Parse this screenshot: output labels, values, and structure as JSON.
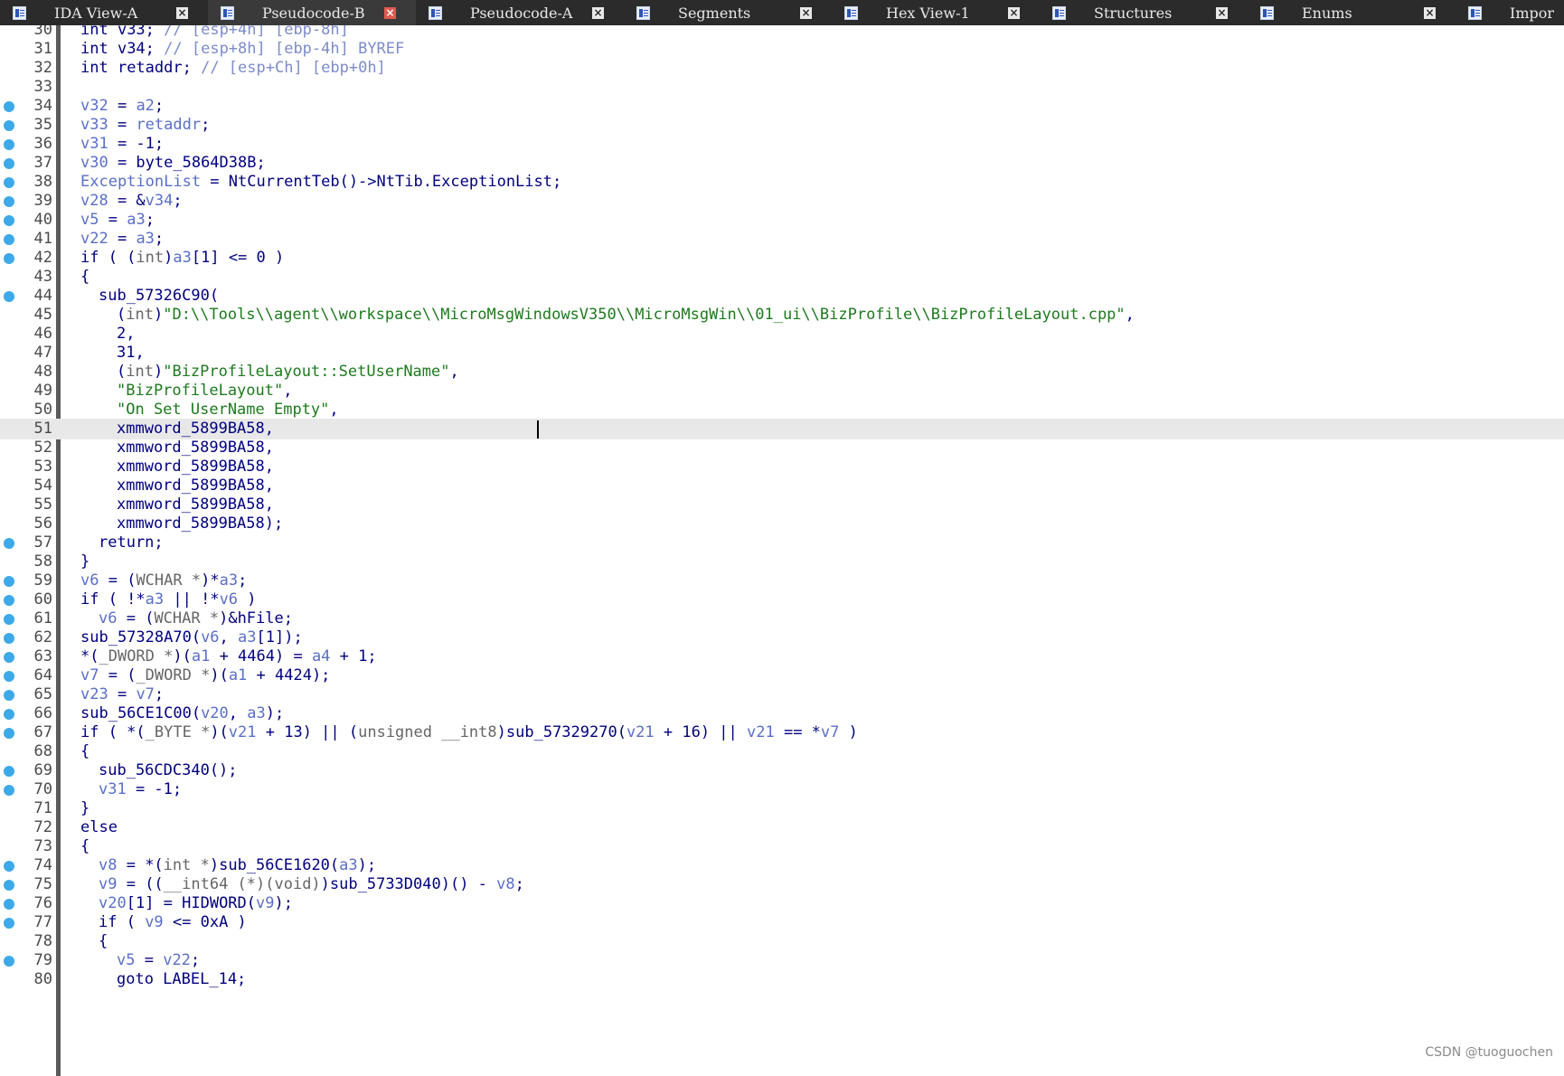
{
  "tabs": [
    {
      "label": "IDA View-A",
      "active": false,
      "close": "×"
    },
    {
      "label": "Pseudocode-B",
      "active": true,
      "close": "×"
    },
    {
      "label": "Pseudocode-A",
      "active": false,
      "close": "×"
    },
    {
      "label": "Segments",
      "active": false,
      "close": "×"
    },
    {
      "label": "Hex View-1",
      "active": false,
      "close": "×"
    },
    {
      "label": "Structures",
      "active": false,
      "close": "×"
    },
    {
      "label": "Enums",
      "active": false,
      "close": "×"
    },
    {
      "label": "Impor",
      "active": false,
      "close": ""
    }
  ],
  "current_line": 51,
  "lines": [
    {
      "n": "30",
      "bp": false,
      "indent": 1,
      "tokens": [
        [
          "p",
          "int "
        ],
        [
          "p",
          "v33"
        ],
        [
          "p",
          "; "
        ],
        [
          "c",
          "// [esp+4h] [ebp-8h]"
        ]
      ]
    },
    {
      "n": "31",
      "bp": false,
      "indent": 1,
      "tokens": [
        [
          "p",
          "int "
        ],
        [
          "p",
          "v34"
        ],
        [
          "p",
          "; "
        ],
        [
          "c",
          "// [esp+8h] [ebp-4h] BYREF"
        ]
      ]
    },
    {
      "n": "32",
      "bp": false,
      "indent": 1,
      "tokens": [
        [
          "p",
          "int "
        ],
        [
          "p",
          "retaddr"
        ],
        [
          "p",
          "; "
        ],
        [
          "c",
          "// [esp+Ch] [ebp+0h]"
        ]
      ]
    },
    {
      "n": "33",
      "bp": false,
      "indent": 1,
      "tokens": []
    },
    {
      "n": "34",
      "bp": true,
      "indent": 1,
      "tokens": [
        [
          "v",
          "v32"
        ],
        [
          "p",
          " = "
        ],
        [
          "v",
          "a2"
        ],
        [
          "p",
          ";"
        ]
      ]
    },
    {
      "n": "35",
      "bp": true,
      "indent": 1,
      "tokens": [
        [
          "v",
          "v33"
        ],
        [
          "p",
          " = "
        ],
        [
          "v",
          "retaddr"
        ],
        [
          "p",
          ";"
        ]
      ]
    },
    {
      "n": "36",
      "bp": true,
      "indent": 1,
      "tokens": [
        [
          "v",
          "v31"
        ],
        [
          "p",
          " = -1;"
        ]
      ]
    },
    {
      "n": "37",
      "bp": true,
      "indent": 1,
      "tokens": [
        [
          "v",
          "v30"
        ],
        [
          "p",
          " = byte_5864D38B;"
        ]
      ]
    },
    {
      "n": "38",
      "bp": true,
      "indent": 1,
      "tokens": [
        [
          "v",
          "ExceptionList"
        ],
        [
          "p",
          " = NtCurrentTeb()->NtTib.ExceptionList;"
        ]
      ]
    },
    {
      "n": "39",
      "bp": true,
      "indent": 1,
      "tokens": [
        [
          "v",
          "v28"
        ],
        [
          "p",
          " = &"
        ],
        [
          "v",
          "v34"
        ],
        [
          "p",
          ";"
        ]
      ]
    },
    {
      "n": "40",
      "bp": true,
      "indent": 1,
      "tokens": [
        [
          "v",
          "v5"
        ],
        [
          "p",
          " = "
        ],
        [
          "v",
          "a3"
        ],
        [
          "p",
          ";"
        ]
      ]
    },
    {
      "n": "41",
      "bp": true,
      "indent": 1,
      "tokens": [
        [
          "v",
          "v22"
        ],
        [
          "p",
          " = "
        ],
        [
          "v",
          "a3"
        ],
        [
          "p",
          ";"
        ]
      ]
    },
    {
      "n": "42",
      "bp": true,
      "indent": 1,
      "tokens": [
        [
          "p",
          "if ( ("
        ],
        [
          "g",
          "int"
        ],
        [
          "p",
          ")"
        ],
        [
          "v",
          "a3"
        ],
        [
          "p",
          "[1] <= 0 )"
        ]
      ]
    },
    {
      "n": "43",
      "bp": false,
      "indent": 1,
      "tokens": [
        [
          "p",
          "{"
        ]
      ]
    },
    {
      "n": "44",
      "bp": true,
      "indent": 2,
      "tokens": [
        [
          "p",
          "sub_57326C90("
        ]
      ]
    },
    {
      "n": "45",
      "bp": false,
      "indent": 3,
      "tokens": [
        [
          "p",
          "("
        ],
        [
          "g",
          "int"
        ],
        [
          "p",
          ")"
        ],
        [
          "s",
          "\"D:\\\\Tools\\\\agent\\\\workspace\\\\MicroMsgWindowsV350\\\\MicroMsgWin\\\\01_ui\\\\BizProfile\\\\BizProfileLayout.cpp\""
        ],
        [
          "p",
          ","
        ]
      ]
    },
    {
      "n": "46",
      "bp": false,
      "indent": 3,
      "tokens": [
        [
          "p",
          "2,"
        ]
      ]
    },
    {
      "n": "47",
      "bp": false,
      "indent": 3,
      "tokens": [
        [
          "p",
          "31,"
        ]
      ]
    },
    {
      "n": "48",
      "bp": false,
      "indent": 3,
      "tokens": [
        [
          "p",
          "("
        ],
        [
          "g",
          "int"
        ],
        [
          "p",
          ")"
        ],
        [
          "s",
          "\"BizProfileLayout::SetUserName\""
        ],
        [
          "p",
          ","
        ]
      ]
    },
    {
      "n": "49",
      "bp": false,
      "indent": 3,
      "tokens": [
        [
          "s",
          "\"BizProfileLayout\""
        ],
        [
          "p",
          ","
        ]
      ]
    },
    {
      "n": "50",
      "bp": false,
      "indent": 3,
      "tokens": [
        [
          "s",
          "\"On Set UserName Empty\""
        ],
        [
          "p",
          ","
        ]
      ]
    },
    {
      "n": "51",
      "bp": false,
      "indent": 3,
      "tokens": [
        [
          "p",
          "xmmword_5899BA58,"
        ]
      ]
    },
    {
      "n": "52",
      "bp": false,
      "indent": 3,
      "tokens": [
        [
          "p",
          "xmmword_5899BA58,"
        ]
      ]
    },
    {
      "n": "53",
      "bp": false,
      "indent": 3,
      "tokens": [
        [
          "p",
          "xmmword_5899BA58,"
        ]
      ]
    },
    {
      "n": "54",
      "bp": false,
      "indent": 3,
      "tokens": [
        [
          "p",
          "xmmword_5899BA58,"
        ]
      ]
    },
    {
      "n": "55",
      "bp": false,
      "indent": 3,
      "tokens": [
        [
          "p",
          "xmmword_5899BA58,"
        ]
      ]
    },
    {
      "n": "56",
      "bp": false,
      "indent": 3,
      "tokens": [
        [
          "p",
          "xmmword_5899BA58);"
        ]
      ]
    },
    {
      "n": "57",
      "bp": true,
      "indent": 2,
      "tokens": [
        [
          "p",
          "return;"
        ]
      ]
    },
    {
      "n": "58",
      "bp": false,
      "indent": 1,
      "tokens": [
        [
          "p",
          "}"
        ]
      ]
    },
    {
      "n": "59",
      "bp": true,
      "indent": 1,
      "tokens": [
        [
          "v",
          "v6"
        ],
        [
          "p",
          " = ("
        ],
        [
          "g",
          "WCHAR *"
        ],
        [
          "p",
          ")*"
        ],
        [
          "v",
          "a3"
        ],
        [
          "p",
          ";"
        ]
      ]
    },
    {
      "n": "60",
      "bp": true,
      "indent": 1,
      "tokens": [
        [
          "p",
          "if ( !*"
        ],
        [
          "v",
          "a3"
        ],
        [
          "p",
          " || !*"
        ],
        [
          "v",
          "v6"
        ],
        [
          "p",
          " )"
        ]
      ]
    },
    {
      "n": "61",
      "bp": true,
      "indent": 2,
      "tokens": [
        [
          "v",
          "v6"
        ],
        [
          "p",
          " = ("
        ],
        [
          "g",
          "WCHAR *"
        ],
        [
          "p",
          ")&hFile;"
        ]
      ]
    },
    {
      "n": "62",
      "bp": true,
      "indent": 1,
      "tokens": [
        [
          "p",
          "sub_57328A70("
        ],
        [
          "v",
          "v6"
        ],
        [
          "p",
          ", "
        ],
        [
          "v",
          "a3"
        ],
        [
          "p",
          "[1]);"
        ]
      ]
    },
    {
      "n": "63",
      "bp": true,
      "indent": 1,
      "tokens": [
        [
          "p",
          "*("
        ],
        [
          "g",
          "_DWORD *"
        ],
        [
          "p",
          ")("
        ],
        [
          "v",
          "a1"
        ],
        [
          "p",
          " + 4464) = "
        ],
        [
          "v",
          "a4"
        ],
        [
          "p",
          " + 1;"
        ]
      ]
    },
    {
      "n": "64",
      "bp": true,
      "indent": 1,
      "tokens": [
        [
          "v",
          "v7"
        ],
        [
          "p",
          " = ("
        ],
        [
          "g",
          "_DWORD *"
        ],
        [
          "p",
          ")("
        ],
        [
          "v",
          "a1"
        ],
        [
          "p",
          " + 4424);"
        ]
      ]
    },
    {
      "n": "65",
      "bp": true,
      "indent": 1,
      "tokens": [
        [
          "v",
          "v23"
        ],
        [
          "p",
          " = "
        ],
        [
          "v",
          "v7"
        ],
        [
          "p",
          ";"
        ]
      ]
    },
    {
      "n": "66",
      "bp": true,
      "indent": 1,
      "tokens": [
        [
          "p",
          "sub_56CE1C00("
        ],
        [
          "v",
          "v20"
        ],
        [
          "p",
          ", "
        ],
        [
          "v",
          "a3"
        ],
        [
          "p",
          ");"
        ]
      ]
    },
    {
      "n": "67",
      "bp": true,
      "indent": 1,
      "tokens": [
        [
          "p",
          "if ( *("
        ],
        [
          "g",
          "_BYTE *"
        ],
        [
          "p",
          ")("
        ],
        [
          "v",
          "v21"
        ],
        [
          "p",
          " + 13) || ("
        ],
        [
          "g",
          "unsigned __int8"
        ],
        [
          "p",
          ")sub_57329270("
        ],
        [
          "v",
          "v21"
        ],
        [
          "p",
          " + 16) || "
        ],
        [
          "v",
          "v21"
        ],
        [
          "p",
          " == *"
        ],
        [
          "v",
          "v7"
        ],
        [
          "p",
          " )"
        ]
      ]
    },
    {
      "n": "68",
      "bp": false,
      "indent": 1,
      "tokens": [
        [
          "p",
          "{"
        ]
      ]
    },
    {
      "n": "69",
      "bp": true,
      "indent": 2,
      "tokens": [
        [
          "p",
          "sub_56CDC340();"
        ]
      ]
    },
    {
      "n": "70",
      "bp": true,
      "indent": 2,
      "tokens": [
        [
          "v",
          "v31"
        ],
        [
          "p",
          " = -1;"
        ]
      ]
    },
    {
      "n": "71",
      "bp": false,
      "indent": 1,
      "tokens": [
        [
          "p",
          "}"
        ]
      ]
    },
    {
      "n": "72",
      "bp": false,
      "indent": 1,
      "tokens": [
        [
          "p",
          "else"
        ]
      ]
    },
    {
      "n": "73",
      "bp": false,
      "indent": 1,
      "tokens": [
        [
          "p",
          "{"
        ]
      ]
    },
    {
      "n": "74",
      "bp": true,
      "indent": 2,
      "tokens": [
        [
          "v",
          "v8"
        ],
        [
          "p",
          " = *("
        ],
        [
          "g",
          "int *"
        ],
        [
          "p",
          ")sub_56CE1620("
        ],
        [
          "v",
          "a3"
        ],
        [
          "p",
          ");"
        ]
      ]
    },
    {
      "n": "75",
      "bp": true,
      "indent": 2,
      "tokens": [
        [
          "v",
          "v9"
        ],
        [
          "p",
          " = (("
        ],
        [
          "g",
          "__int64 (*)(void)"
        ],
        [
          "p",
          ")sub_5733D040)() - "
        ],
        [
          "v",
          "v8"
        ],
        [
          "p",
          ";"
        ]
      ]
    },
    {
      "n": "76",
      "bp": true,
      "indent": 2,
      "tokens": [
        [
          "v",
          "v20"
        ],
        [
          "p",
          "[1] = HIDWORD("
        ],
        [
          "v",
          "v9"
        ],
        [
          "p",
          ");"
        ]
      ]
    },
    {
      "n": "77",
      "bp": true,
      "indent": 2,
      "tokens": [
        [
          "p",
          "if ( "
        ],
        [
          "v",
          "v9"
        ],
        [
          "p",
          " <= 0xA )"
        ]
      ]
    },
    {
      "n": "78",
      "bp": false,
      "indent": 2,
      "tokens": [
        [
          "p",
          "{"
        ]
      ]
    },
    {
      "n": "79",
      "bp": true,
      "indent": 3,
      "tokens": [
        [
          "v",
          "v5"
        ],
        [
          "p",
          " = "
        ],
        [
          "v",
          "v22"
        ],
        [
          "p",
          ";"
        ]
      ]
    },
    {
      "n": "80",
      "bp": false,
      "indent": 3,
      "tokens": [
        [
          "p",
          "goto LABEL_14;"
        ]
      ]
    }
  ],
  "watermark": "CSDN @tuoguochen",
  "colors": {
    "plain": "#000080",
    "var": "#5a6fc8",
    "comment": "#7d8bc9",
    "string": "#1e7a1e",
    "type": "#666666",
    "breakpoint": "#3da9e8"
  }
}
